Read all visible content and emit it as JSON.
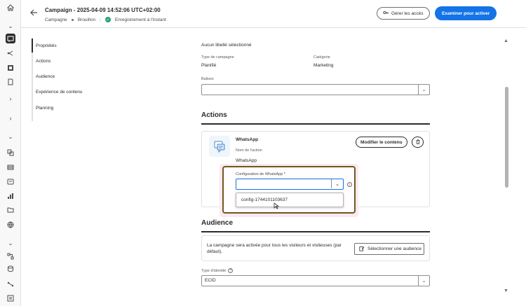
{
  "header": {
    "title": "Campaign - 2025-04-09 14:52:06 UTC+02:00",
    "type": "Campagne",
    "status": "Brouillon",
    "saved": "Enregistrement à l'instant",
    "manage_access": "Gérer les accès",
    "review_activate": "Examiner pour activer"
  },
  "leftnav": {
    "items": [
      "Propriétés",
      "Actions",
      "Audience",
      "Expérience de contenu",
      "Planning"
    ]
  },
  "properties": {
    "no_label": "Aucun libellé sélectionné",
    "campaign_type_label": "Type de campagne",
    "campaign_type_value": "Planifié",
    "category_label": "Catégorie",
    "category_value": "Marketing",
    "tags_label": "Balises"
  },
  "actions": {
    "title": "Actions",
    "channel_name": "WhatsApp",
    "action_name_label": "Nom de l'action",
    "action_name_value": "WhatsApp",
    "modify_content": "Modifier le contenu",
    "config_label": "Configuration de WhatsApp",
    "required_mark": "*",
    "config_option": "config-1744101103637"
  },
  "audience": {
    "title": "Audience",
    "description": "La campagne sera activée pour tous les visiteurs et visiteuses (par défaut).",
    "select_audience": "Sélectionner une audience",
    "identity_type_label": "Type d'identité",
    "identity_type_value": "ECID"
  },
  "icons": {
    "back": "arrow-left-icon",
    "home": "home-icon",
    "campaign": "campaign-icon",
    "check": "check-circle-icon",
    "key": "key-icon",
    "trash": "trash-icon",
    "audience": "audience-edit-icon",
    "info": "info-icon",
    "help": "help-icon",
    "chevron": "chevron-down-icon"
  },
  "colors": {
    "primary": "#1473e6",
    "success": "#2d9d78",
    "highlight_border": "#6b5a1e"
  }
}
